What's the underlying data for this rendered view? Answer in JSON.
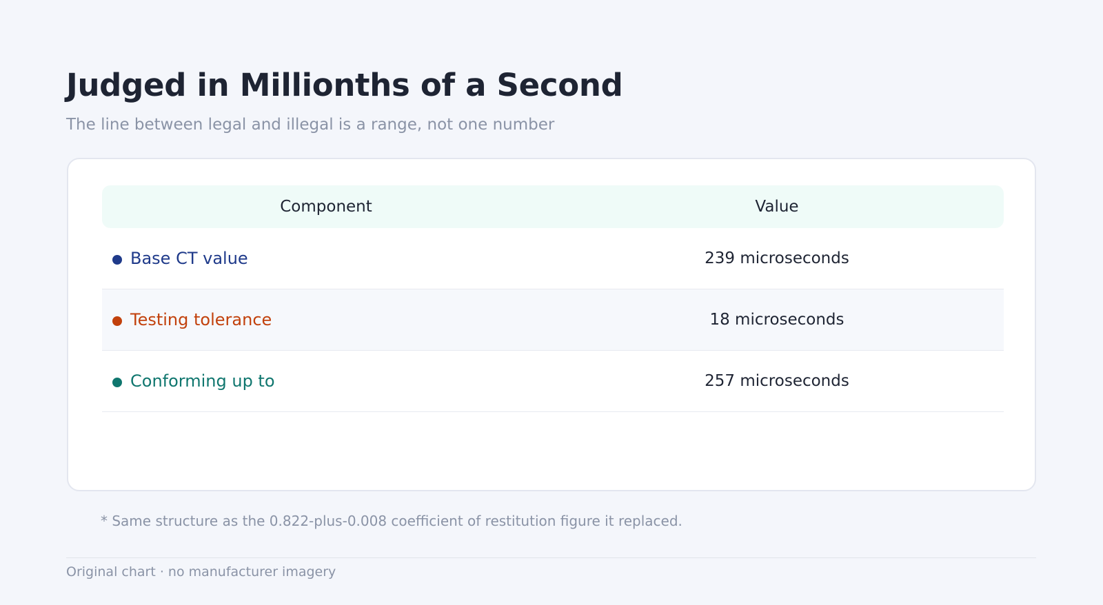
{
  "title": "Judged in Millionths of a Second",
  "subtitle": "The line between legal and illegal is a range, not one number",
  "table": {
    "headers": {
      "component": "Component",
      "value": "Value"
    },
    "rows": [
      {
        "component": "Base CT value",
        "value": "239 microseconds",
        "color": "#1f3a8a"
      },
      {
        "component": "Testing tolerance",
        "value": "18 microseconds",
        "color": "#c2410c"
      },
      {
        "component": "Conforming up to",
        "value": "257 microseconds",
        "color": "#0f766e"
      }
    ]
  },
  "chart_data": {
    "type": "table",
    "columns": [
      "Component",
      "Value"
    ],
    "rows": [
      [
        "Base CT value",
        "239 microseconds"
      ],
      [
        "Testing tolerance",
        "18 microseconds"
      ],
      [
        "Conforming up to",
        "257 microseconds"
      ]
    ],
    "values": [
      239,
      18,
      257
    ],
    "unit": "microseconds",
    "title": "Judged in Millionths of a Second",
    "subtitle": "The line between legal and illegal is a range, not one number"
  },
  "footnote": "* Same structure as the 0.822-plus-0.008 coefficient of restitution figure it replaced.",
  "source": "Original chart · no manufacturer imagery"
}
